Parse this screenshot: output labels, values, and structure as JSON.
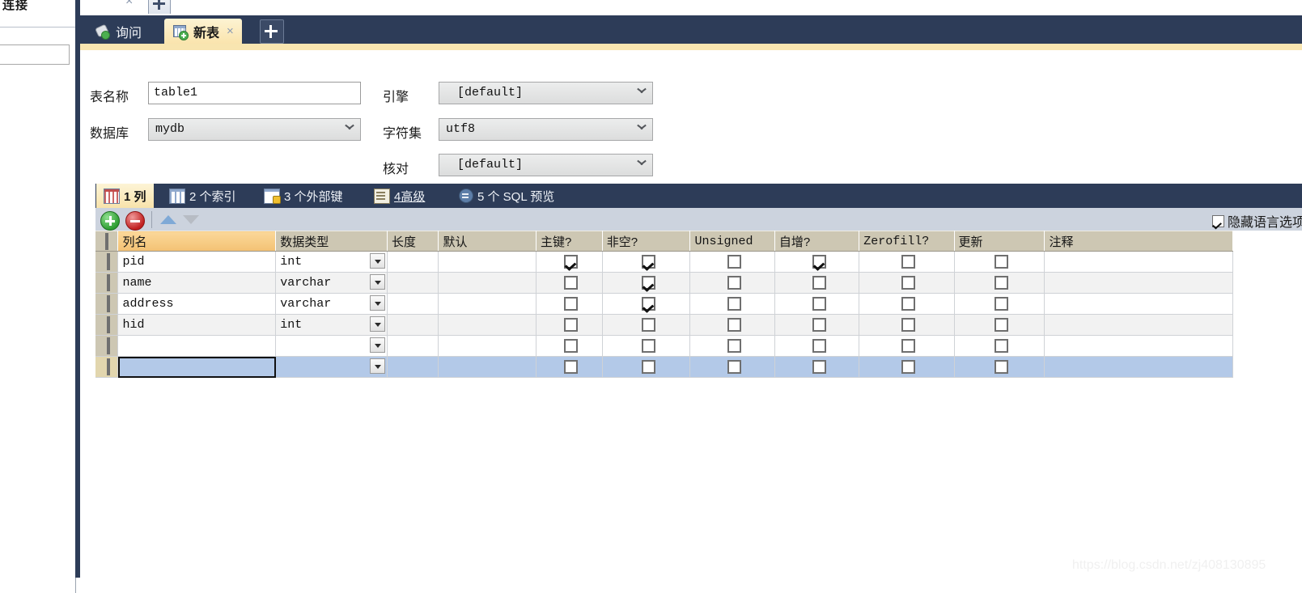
{
  "window": {
    "clipped_tab_label": "连接",
    "close_label": "×",
    "new_tab_label": "+"
  },
  "sidebar": {
    "search_value": ""
  },
  "tabs": [
    {
      "label": "询问",
      "icon": "query-icon",
      "active": false,
      "closable": false
    },
    {
      "label": "新表",
      "icon": "new-table-icon",
      "active": true,
      "closable": true,
      "close_label": "×"
    }
  ],
  "new_tab_button": {
    "label": "+"
  },
  "form": {
    "table_name": {
      "label": "表名称",
      "value": "table1",
      "placeholder": ""
    },
    "database": {
      "label": "数据库",
      "value": "mydb"
    },
    "engine": {
      "label": "引擎",
      "value": "[default]"
    },
    "charset": {
      "label": "字符集",
      "value": "utf8"
    },
    "collation": {
      "label": "核对",
      "value": "[default]"
    }
  },
  "subtabs": [
    {
      "label": "1 列",
      "icon": "columns-icon",
      "active": true
    },
    {
      "label": "2 个索引",
      "icon": "index-icon",
      "active": false
    },
    {
      "label": "3 个外部键",
      "icon": "foreign-key-icon",
      "active": false
    },
    {
      "label": "4高级",
      "icon": "advanced-icon",
      "active": false,
      "underline_first": true
    },
    {
      "label": "5 个 SQL 预览",
      "icon": "sql-preview-icon",
      "active": false
    }
  ],
  "grid_toolbar": {
    "add_label": "+",
    "remove_label": "−",
    "move_up_label": "▲",
    "move_down_label": "▼",
    "hide_language_options": {
      "label": "隐藏语言选项",
      "checked": true
    }
  },
  "grid": {
    "headers": [
      "列名",
      "数据类型",
      "长度",
      "默认",
      "主键?",
      "非空?",
      "Unsigned",
      "自增?",
      "Zerofill?",
      "更新",
      "注释"
    ],
    "highlighted_header": "列名",
    "rows": [
      {
        "name": "pid",
        "type": "int",
        "length": "",
        "default": "",
        "pk": true,
        "notnull": true,
        "unsigned": false,
        "autoinc": true,
        "zerofill": false,
        "update": false,
        "comment": "",
        "selected": false
      },
      {
        "name": "name",
        "type": "varchar",
        "length": "",
        "default": "",
        "pk": false,
        "notnull": true,
        "unsigned": false,
        "autoinc": false,
        "zerofill": false,
        "update": false,
        "comment": "",
        "selected": false
      },
      {
        "name": "address",
        "type": "varchar",
        "length": "",
        "default": "",
        "pk": false,
        "notnull": true,
        "unsigned": false,
        "autoinc": false,
        "zerofill": false,
        "update": false,
        "comment": "",
        "selected": false
      },
      {
        "name": "hid",
        "type": "int",
        "length": "",
        "default": "",
        "pk": false,
        "notnull": false,
        "unsigned": false,
        "autoinc": false,
        "zerofill": false,
        "update": false,
        "comment": "",
        "selected": false
      },
      {
        "name": "",
        "type": "",
        "length": "",
        "default": "",
        "pk": false,
        "notnull": false,
        "unsigned": false,
        "autoinc": false,
        "zerofill": false,
        "update": false,
        "comment": "",
        "selected": false
      },
      {
        "name": "",
        "type": "",
        "length": "",
        "default": "",
        "pk": false,
        "notnull": false,
        "unsigned": false,
        "autoinc": false,
        "zerofill": false,
        "update": false,
        "comment": "",
        "selected": true
      }
    ]
  },
  "watermark": {
    "text": "https://blog.csdn.net/zj408130895"
  },
  "colors": {
    "tabbar_navy": "#2d3c58",
    "active_tab_yellow": "#f8e3ab",
    "grid_header_tan": "#cdc7b3",
    "grid_header_highlight": "#f3c173",
    "row_selected_blue": "#b3c9e8",
    "toolbar_grey": "#ccd3de",
    "add_green": "#2f9e33",
    "remove_red": "#c12020"
  }
}
